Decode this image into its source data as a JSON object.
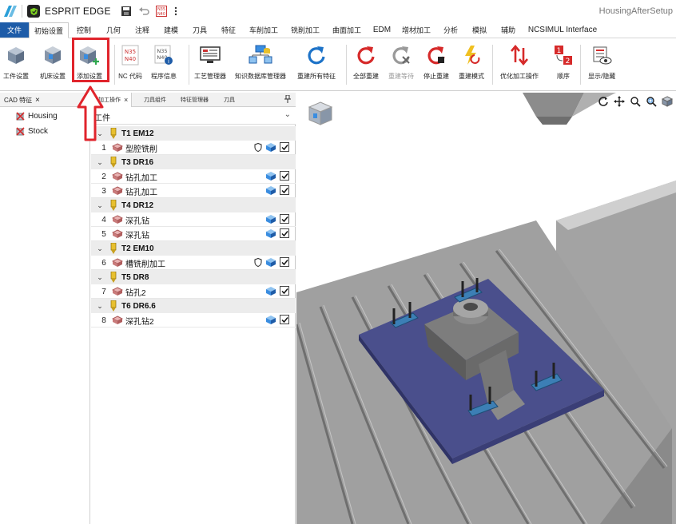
{
  "titlebar": {
    "app_name": "ESPRIT EDGE",
    "doc_title": "HousingAfterSetup"
  },
  "menu": {
    "file": "文件",
    "tabs": [
      "初始设置",
      "控制",
      "几何",
      "注释",
      "建模",
      "刀具",
      "特征",
      "车削加工",
      "铣削加工",
      "曲面加工",
      "EDM",
      "增材加工",
      "分析",
      "模拟",
      "辅助",
      "NCSIMUL Interface"
    ]
  },
  "ribbon": {
    "workpiece_setup": "工件设置",
    "machine_setup": "机床设置",
    "add_setup": "添加设置",
    "nc_code": "NC 代码",
    "program_info": "程序信息",
    "process_manager": "工艺管理器",
    "knowledge_db": "知识数据库管理器",
    "rebuild_all_features": "重建所有特征",
    "rebuild_all": "全部重建",
    "rebuild_wait": "重建等待",
    "stop_rebuild": "停止重建",
    "rebuild_mode": "重建模式",
    "optimize_ops": "优化加工操作",
    "order": "顺序",
    "show_hide": "显示/隐藏",
    "nc_icon_line1": "N35",
    "nc_icon_line2": "N40"
  },
  "cad_panel": {
    "tab_label": "CAD 特征",
    "close": "×",
    "items": [
      "Housing",
      "Stock"
    ]
  },
  "ops_panel": {
    "tabs": [
      "加工操作",
      "刀具组件",
      "特征管理器",
      "刀具"
    ],
    "close": "×",
    "pin": "📌",
    "filter": "工件",
    "groups": [
      {
        "tool": "T1 EM12",
        "ops": [
          {
            "num": "1",
            "name": "型腔铣削",
            "shield": true
          }
        ]
      },
      {
        "tool": "T3 DR16",
        "ops": [
          {
            "num": "2",
            "name": "钻孔加工",
            "shield": false
          },
          {
            "num": "3",
            "name": "钻孔加工",
            "shield": false
          }
        ]
      },
      {
        "tool": "T4 DR12",
        "ops": [
          {
            "num": "4",
            "name": "深孔钻",
            "shield": false
          },
          {
            "num": "5",
            "name": "深孔钻",
            "shield": false
          }
        ]
      },
      {
        "tool": "T2 EM10",
        "ops": [
          {
            "num": "6",
            "name": "槽铣削加工",
            "shield": true
          }
        ]
      },
      {
        "tool": "T5 DR8",
        "ops": [
          {
            "num": "7",
            "name": "钻孔2",
            "shield": false
          }
        ]
      },
      {
        "tool": "T6 DR6.6",
        "ops": [
          {
            "num": "8",
            "name": "深孔钻2",
            "shield": false
          }
        ]
      }
    ]
  },
  "colors": {
    "file_tab": "#1e5ca8",
    "highlight": "#e0242c",
    "fixture_plate": "#4a4f8c",
    "table_gray": "#9a9a9a"
  }
}
